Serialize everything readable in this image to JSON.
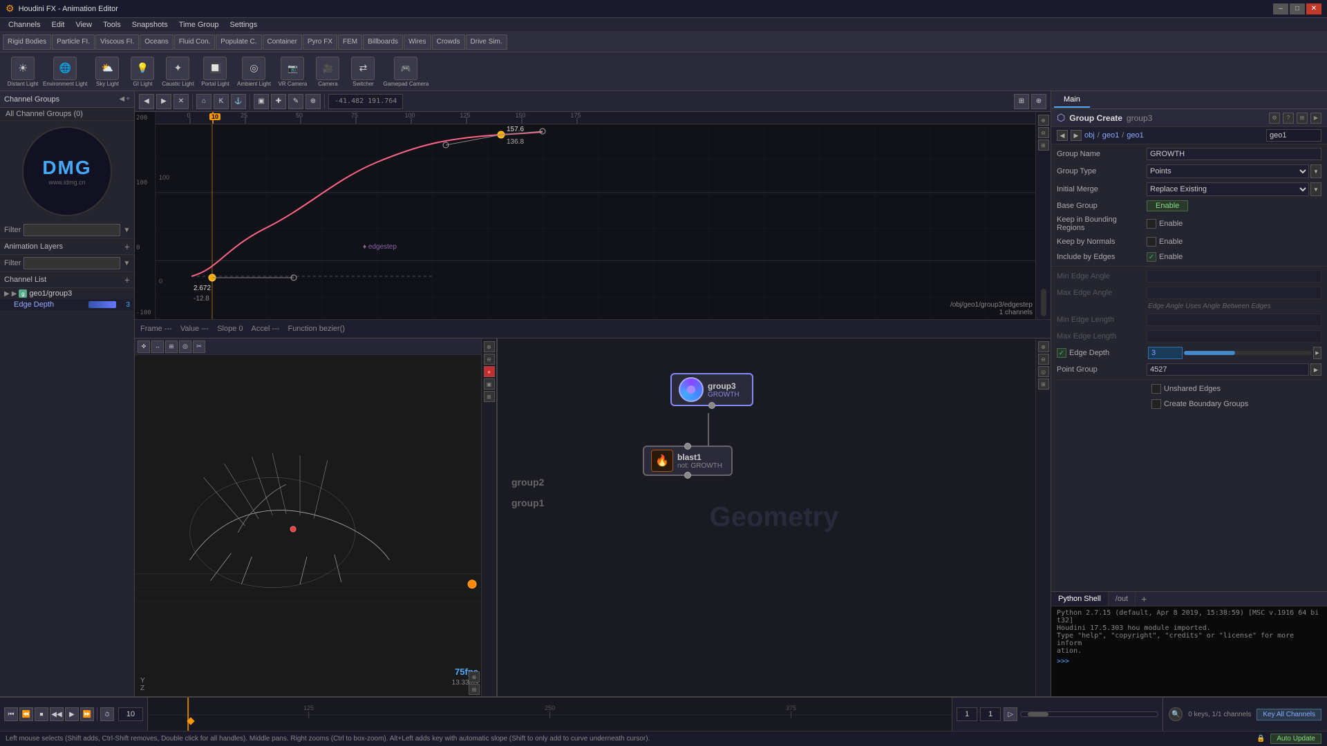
{
  "window": {
    "title": "Houdini FX - Animation Editor",
    "minimize": "–",
    "maximize": "□",
    "close": "✕"
  },
  "menu": {
    "items": [
      "Channels",
      "Edit",
      "View",
      "Tools",
      "Snapshots",
      "Time Group",
      "Settings"
    ]
  },
  "channel_groups": {
    "title": "Channel Groups",
    "all_label": "All Channel Groups (0)"
  },
  "filter": {
    "label": "Filter",
    "value": ""
  },
  "animation_layers": {
    "label": "Animation Layers"
  },
  "channel_list": {
    "label": "Channel List",
    "items": [
      {
        "path": "geo1/group3",
        "sub": ""
      }
    ],
    "edge_depth": {
      "label": "Edge Depth",
      "value": "3",
      "color": "#4444ff"
    }
  },
  "anim_editor": {
    "frame_label": "Frame ---",
    "value_label": "Value ---",
    "slope_label": "Slope  0",
    "accel_label": "Accel ---",
    "function_label": "Function bezier()",
    "curve_values": {
      "y_157_6": "157.6",
      "y_136_8": "136.8",
      "y_2_672": "2.672",
      "y_12_8": "-12.8",
      "y_100": "100",
      "y_0": "0",
      "path_label": "/obj/geo1/group3/edgestep",
      "channels_label": "1 channels"
    }
  },
  "viewport": {
    "fps": "75fps",
    "time": "13.33ms",
    "axes_label": "Y Z"
  },
  "node_editor": {
    "nodes": [
      {
        "id": "group3",
        "label": "group3",
        "sublabel": "GROWTH",
        "type": "group",
        "icon": "🔵"
      },
      {
        "id": "blast1",
        "label": "blast1",
        "sublabel": "not: GROWTH",
        "type": "blast",
        "icon": "🔥"
      }
    ],
    "geometry_label": "Geometry",
    "groups": [
      "group2",
      "group1"
    ]
  },
  "right_panel": {
    "tabs": [
      "Main"
    ],
    "breadcrumb": "obj / geo1 / geo1",
    "op_name": "Group Create",
    "node_name": "group3",
    "properties": {
      "group_name_label": "Group Name",
      "group_name_value": "GROWTH",
      "group_type_label": "Group Type",
      "group_type_value": "Points",
      "initial_merge_label": "Initial Merge",
      "initial_merge_value": "Replace Existing",
      "base_group_label": "Base Group",
      "base_group_btn": "Enable",
      "keep_bounding_label": "Keep in Bounding Regions",
      "keep_bounding_enable": "Enable",
      "keep_normals_label": "Keep by Normals",
      "keep_normals_enable": "Enable",
      "include_by_edges_label": "Include by Edges",
      "include_by_edges_enable": "Enable",
      "min_edge_angle_label": "Min Edge Angle",
      "max_edge_angle_label": "Max Edge Angle",
      "edge_angle_note": "Edge Angle Uses Angle Between Edges",
      "min_edge_length_label": "Min Edge Length",
      "max_edge_length_label": "Max Edge Length",
      "edge_depth_label": "Edge Depth",
      "edge_depth_value": "3",
      "point_group_label": "Point Group",
      "point_group_value": "4527",
      "unshared_edges": "Unshared Edges",
      "create_boundary": "Create Boundary Groups"
    }
  },
  "python_shell": {
    "tab_label": "/out",
    "add_btn": "+",
    "lines": [
      "Python 2.7.15 (default, Apr  8 2019, 15:38:59) [MSC v.1916 64 bi",
      "t32]",
      "Houdini 17.5.303 hou module imported.",
      "Type \"help\", \"copyright\", \"credits\" or \"license\" for more inform",
      "ation.",
      ">>> "
    ]
  },
  "timeline": {
    "frame_field": "10",
    "start_frame": "1",
    "end_frame": "1",
    "ticks": [
      "125",
      "250",
      "375"
    ]
  },
  "status_bar": {
    "message": "Left mouse selects (Shift adds, Ctrl-Shift removes, Double click for all handles). Middle pans. Right zooms (Ctrl to box-zoom). Alt+Left adds key with automatic slope (Shift to only add to curve underneath cursor).",
    "keys_count": "0 keys, 1/1 channels",
    "key_all_label": "Key All Channels",
    "auto_update": "Auto Update"
  },
  "lights": {
    "items": [
      {
        "label": "Distant Light",
        "icon": "☀"
      },
      {
        "label": "Environment\nLight",
        "icon": "🌐"
      },
      {
        "label": "Sky Light",
        "icon": "⛅"
      },
      {
        "label": "GI Light",
        "icon": "💡"
      },
      {
        "label": "Caustic Light",
        "icon": "✦"
      },
      {
        "label": "Portal Light",
        "icon": "🔲"
      },
      {
        "label": "Ambient Light",
        "icon": "◎"
      },
      {
        "label": "VR Camera",
        "icon": "📷"
      },
      {
        "label": "Camera",
        "icon": "🎥"
      },
      {
        "label": "Gamepad\nCamera",
        "icon": "🎮"
      }
    ],
    "rigid_bodies": "Rigid Bodies",
    "particle_fi": "Particle FI.",
    "viscous_fi": "Viscous FI.",
    "oceans": "Oceans",
    "fluid_con": "Fluid Con.",
    "populate_c": "Populate C.",
    "container": "Container",
    "pyro_fx": "Pyro FX",
    "fem": "FEM",
    "billboards": "Billboards",
    "wires": "Wires",
    "crowds": "Crowds",
    "drive_sim": "Drive Sim.",
    "switcher": "Switcher",
    "gamepad_camera": "Gamepad\nCamera"
  },
  "colors": {
    "accent_blue": "#4a8fff",
    "accent_cyan": "#5af",
    "curve_color": "#ff6688",
    "node_selected": "#8888ff",
    "growth_color": "#8888cc"
  }
}
